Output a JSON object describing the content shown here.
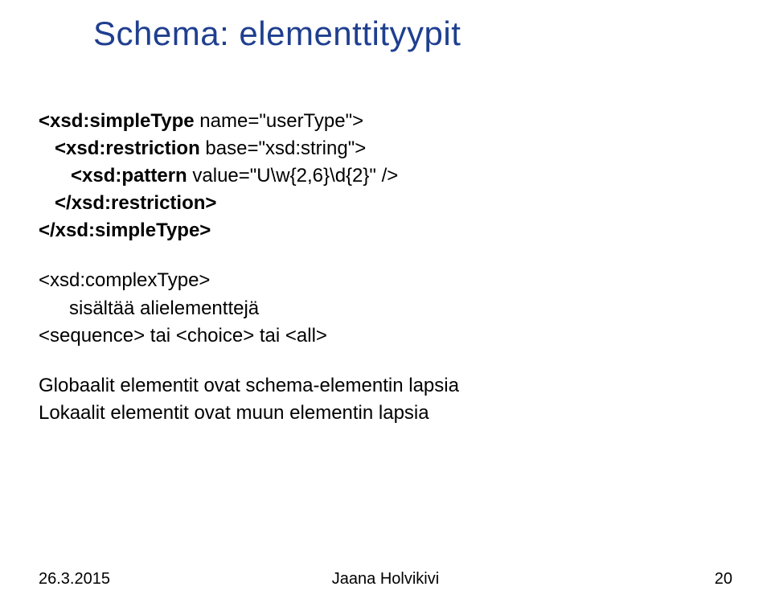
{
  "title": "Schema: elementtityypit",
  "code": {
    "l1": "<xsd:simpleType ",
    "l1b": "name=\"userType\">",
    "l2": "<xsd:restriction ",
    "l2b": "base=\"xsd:string\">",
    "l3": "<xsd:pattern ",
    "l3b": "value=\"U\\w{2,6}\\d{2}\" />",
    "l4": "</xsd:restriction>",
    "l5": "</xsd:simpleType>"
  },
  "body": {
    "p1l1": "<xsd:complexType>",
    "p1l2": "sisältää alielementtejä",
    "p1l3": "<sequence> tai <choice> tai <all>",
    "p2l1": "Globaalit elementit ovat schema-elementin lapsia",
    "p2l2": "Lokaalit elementit ovat muun elementin lapsia"
  },
  "footer": {
    "date": "26.3.2015",
    "author": "Jaana Holvikivi",
    "page": "20"
  }
}
